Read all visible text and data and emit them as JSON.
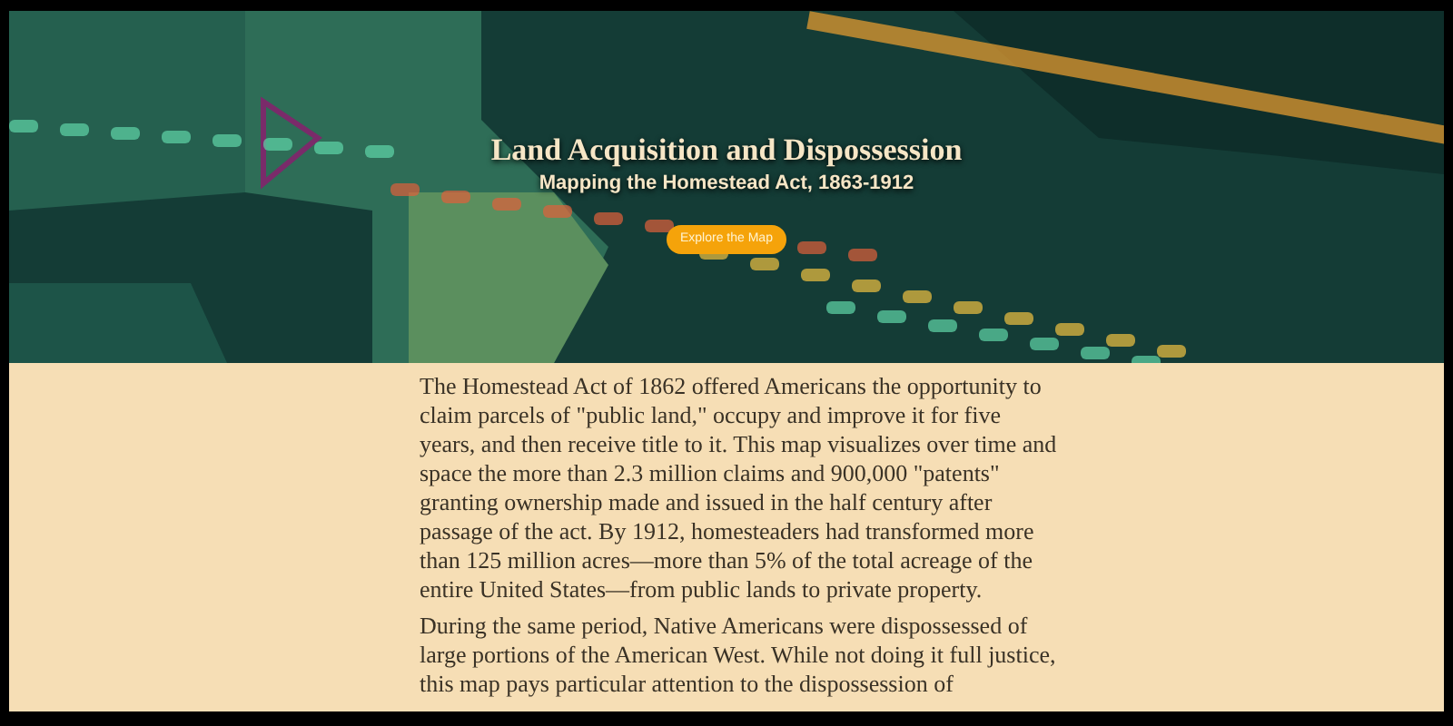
{
  "hero": {
    "kind": "picture",
    "title": "Land Acquisition and Dispossession",
    "subtitle": "Mapping the Homestead Act, 1863-1912",
    "button": "Explore the Map"
  },
  "paragraphs": [
    "The Homestead Act of 1862 offered Americans the opportunity to claim parcels of \"public land,\" occupy and improve it for five years, and then receive title to it. This map visualizes over time and space the more than 2.3 million claims and 900,000 \"patents\" granting ownership made and issued in the half century after passage of the act. By 1912, homesteaders had transformed more than 125 million acres—more than 5% of the total acreage of the entire United States—from public lands to private property.",
    "During the same period, Native Americans were dispossessed of large portions of the American West. While not doing it full justice, this map pays particular attention to the dispossession of"
  ]
}
